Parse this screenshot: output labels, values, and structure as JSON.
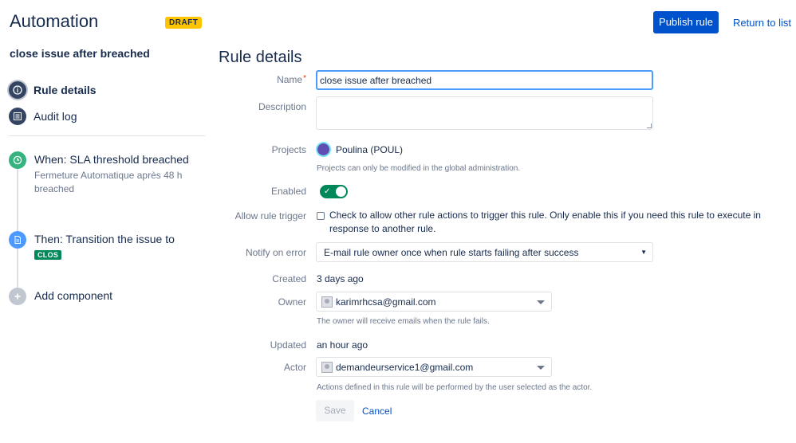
{
  "header": {
    "title": "Automation",
    "status_badge": "DRAFT",
    "publish_label": "Publish rule",
    "return_label": "Return to list"
  },
  "sidebar": {
    "rule_name": "close issue after breached",
    "nav": [
      {
        "label": "Rule details",
        "icon": "info-icon",
        "active": true
      },
      {
        "label": "Audit log",
        "icon": "list-icon",
        "active": false
      }
    ],
    "components": [
      {
        "title": "When: SLA threshold breached",
        "desc": "Fermeture Automatique après 48 h breached",
        "icon": "clock-icon",
        "color": "#36b37e"
      },
      {
        "title": "Then: Transition the issue to",
        "badge": "CLOS",
        "icon": "document-icon",
        "color": "#4c9aff"
      },
      {
        "title": "Add component",
        "icon": "plus-icon",
        "color": "#c1c7d0"
      }
    ]
  },
  "form": {
    "section_title": "Rule details",
    "name_label": "Name",
    "name_value": "close issue after breached",
    "description_label": "Description",
    "description_value": "",
    "projects_label": "Projects",
    "project_name": "Poulina (POUL)",
    "projects_help": "Projects can only be modified in the global administration.",
    "enabled_label": "Enabled",
    "enabled": true,
    "allow_trigger_label": "Allow rule trigger",
    "allow_trigger_text": "Check to allow other rule actions to trigger this rule. Only enable this if you need this rule to execute in response to another rule.",
    "allow_trigger_checked": false,
    "notify_label": "Notify on error",
    "notify_value": "E-mail rule owner once when rule starts failing after success",
    "created_label": "Created",
    "created_value": "3 days ago",
    "owner_label": "Owner",
    "owner_value": "karimrhcsa@gmail.com",
    "owner_help": "The owner will receive emails when the rule fails.",
    "updated_label": "Updated",
    "updated_value": "an hour ago",
    "actor_label": "Actor",
    "actor_value": "demandeurservice1@gmail.com",
    "actor_help": "Actions defined in this rule will be performed by the user selected as the actor.",
    "save_label": "Save",
    "cancel_label": "Cancel"
  },
  "colors": {
    "primary": "#0052cc",
    "draft": "#ffc400",
    "success": "#00875a",
    "text": "#172b4d",
    "subtle": "#6b778c"
  }
}
